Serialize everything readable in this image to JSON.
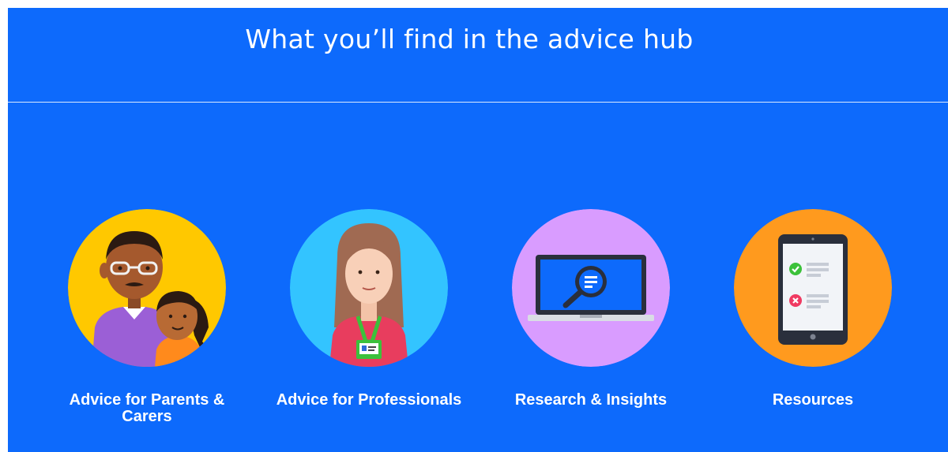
{
  "hub": {
    "title": "What you’ll find in the advice hub",
    "accent_color": "#0d6afc",
    "cards": [
      {
        "label": "Advice for Parents & Carers",
        "icon": "parent-and-child-illustration",
        "circle_color": "#ffc800"
      },
      {
        "label": "Advice for Professionals",
        "icon": "professional-with-lanyard-illustration",
        "circle_color": "#33c4ff"
      },
      {
        "label": "Research & Insights",
        "icon": "laptop-magnifier-illustration",
        "circle_color": "#d99cff"
      },
      {
        "label": "Resources",
        "icon": "tablet-checklist-illustration",
        "circle_color": "#ff9a1e"
      }
    ]
  }
}
